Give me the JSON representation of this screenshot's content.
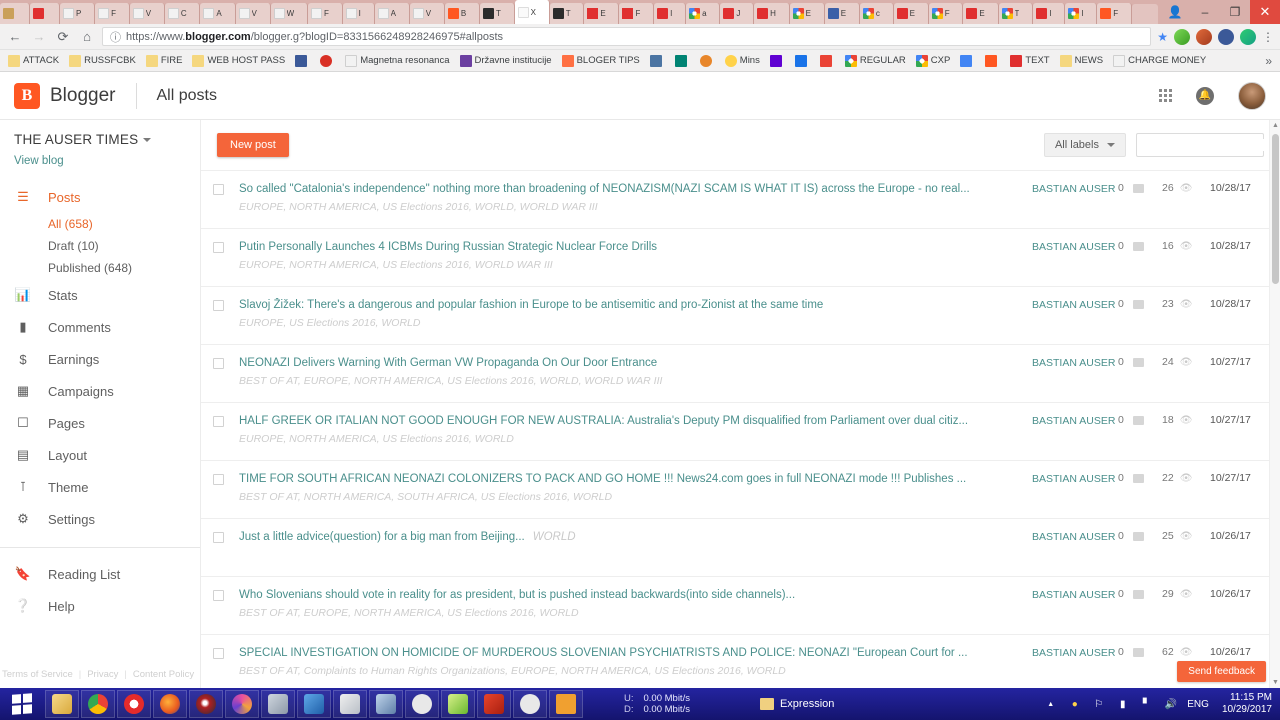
{
  "browser": {
    "window_controls": {
      "minimize": "–",
      "maximize": "❐",
      "close": "✕"
    },
    "nav": {
      "back": "←",
      "forward": "→",
      "reload": "⟳",
      "home": "⌂",
      "info": "ⓘ",
      "star": "★",
      "menu": "⋮"
    },
    "url": {
      "scheme": "https://www.",
      "host": "blogger.com",
      "path": "/blogger.g?blogID=8331566248928246975#allposts"
    },
    "tabs": [
      {
        "label": "",
        "favicon": "shopping-bag",
        "active": false
      },
      {
        "label": "",
        "favicon": "youtube",
        "active": false
      },
      {
        "label": "P",
        "favicon": "page",
        "active": false
      },
      {
        "label": "F",
        "favicon": "page",
        "active": false
      },
      {
        "label": "V",
        "favicon": "page",
        "active": false
      },
      {
        "label": "C",
        "favicon": "page",
        "active": false
      },
      {
        "label": "A",
        "favicon": "page",
        "active": false
      },
      {
        "label": "V",
        "favicon": "page",
        "active": false
      },
      {
        "label": "W",
        "favicon": "page",
        "active": false
      },
      {
        "label": "F",
        "favicon": "page",
        "active": false
      },
      {
        "label": "I",
        "favicon": "page",
        "active": false
      },
      {
        "label": "A",
        "favicon": "page",
        "active": false
      },
      {
        "label": "V",
        "favicon": "page",
        "active": false
      },
      {
        "label": "B",
        "favicon": "blogger",
        "active": false
      },
      {
        "label": "T",
        "favicon": "serif-a",
        "active": false
      },
      {
        "label": "X",
        "favicon": "text",
        "active": true
      },
      {
        "label": "T",
        "favicon": "serif-a",
        "active": false
      },
      {
        "label": "E",
        "favicon": "check",
        "active": false
      },
      {
        "label": "F",
        "favicon": "check",
        "active": false
      },
      {
        "label": "I",
        "favicon": "youtube",
        "active": false
      },
      {
        "label": "a",
        "favicon": "google",
        "active": false
      },
      {
        "label": "J",
        "favicon": "youtube",
        "active": false
      },
      {
        "label": "H",
        "favicon": "youtube",
        "active": false
      },
      {
        "label": "E",
        "favicon": "google",
        "active": false
      },
      {
        "label": "E",
        "favicon": "blue-doc",
        "active": false
      },
      {
        "label": "c",
        "favicon": "google",
        "active": false
      },
      {
        "label": "E",
        "favicon": "youtube",
        "active": false
      },
      {
        "label": "F",
        "favicon": "google",
        "active": false
      },
      {
        "label": "E",
        "favicon": "youtube",
        "active": false
      },
      {
        "label": "T",
        "favicon": "google",
        "active": false
      },
      {
        "label": "I",
        "favicon": "youtube",
        "active": false
      },
      {
        "label": "I",
        "favicon": "google",
        "active": false
      },
      {
        "label": "F",
        "favicon": "blogger",
        "active": false
      }
    ],
    "bookmarks": [
      {
        "label": "ATTACK",
        "icon": "folder"
      },
      {
        "label": "RUSSFCBK",
        "icon": "folder"
      },
      {
        "label": "FIRE",
        "icon": "folder"
      },
      {
        "label": "WEB HOST PASS",
        "icon": "folder"
      },
      {
        "label": "",
        "icon": "facebook"
      },
      {
        "label": "",
        "icon": "red-drop"
      },
      {
        "label": "Magnetna resonanca",
        "icon": "page"
      },
      {
        "label": "Državne institucije",
        "icon": "purple-v"
      },
      {
        "label": "BLOGER TIPS",
        "icon": "orange-bg"
      },
      {
        "label": "",
        "icon": "vk"
      },
      {
        "label": "",
        "icon": "bing"
      },
      {
        "label": "",
        "icon": "orange-circle"
      },
      {
        "label": "Mins",
        "icon": "bulb"
      },
      {
        "label": "",
        "icon": "yahoo"
      },
      {
        "label": "",
        "icon": "blue-square"
      },
      {
        "label": "",
        "icon": "gmail"
      },
      {
        "label": "REGULAR",
        "icon": "google"
      },
      {
        "label": "CXP",
        "icon": "google"
      },
      {
        "label": "",
        "icon": "translate"
      },
      {
        "label": "",
        "icon": "blogger"
      },
      {
        "label": "TEXT",
        "icon": "red-check"
      },
      {
        "label": "NEWS",
        "icon": "folder"
      },
      {
        "label": "CHARGE MONEY",
        "icon": "page"
      }
    ],
    "bookmarks_overflow": "»"
  },
  "app": {
    "brand": {
      "mark": "B",
      "name": "Blogger"
    },
    "page_title": "All posts",
    "header_icons": {
      "apps": "apps-grid",
      "notifications": "bell",
      "account": "avatar"
    }
  },
  "sidebar": {
    "blog_name": "THE AUSER TIMES",
    "view_blog": "View blog",
    "items": [
      {
        "label": "Posts",
        "icon": "posts-icon",
        "active": true
      },
      {
        "label": "Stats",
        "icon": "stats-icon",
        "active": false
      },
      {
        "label": "Comments",
        "icon": "comments-icon",
        "active": false
      },
      {
        "label": "Earnings",
        "icon": "earnings-icon",
        "active": false
      },
      {
        "label": "Campaigns",
        "icon": "campaigns-icon",
        "active": false
      },
      {
        "label": "Pages",
        "icon": "pages-icon",
        "active": false
      },
      {
        "label": "Layout",
        "icon": "layout-icon",
        "active": false
      },
      {
        "label": "Theme",
        "icon": "theme-icon",
        "active": false
      },
      {
        "label": "Settings",
        "icon": "settings-icon",
        "active": false
      }
    ],
    "subitems": [
      {
        "label": "All (658)",
        "active": true
      },
      {
        "label": "Draft (10)",
        "active": false
      },
      {
        "label": "Published (648)",
        "active": false
      }
    ],
    "bottom_items": [
      {
        "label": "Reading List",
        "icon": "bookmark-icon"
      },
      {
        "label": "Help",
        "icon": "help-icon"
      }
    ],
    "footer": {
      "terms": "Terms of Service",
      "privacy": "Privacy",
      "policy": "Content Policy",
      "sep": "|"
    }
  },
  "toolbar": {
    "new_post_label": "New post",
    "labels_filter": "All labels",
    "search_value": "",
    "search_placeholder": ""
  },
  "posts": [
    {
      "title": "So called \"Catalonia's independence\" nothing more than broadening of NEONAZISM(NAZI SCAM IS WHAT IT IS) across the Europe - no real...",
      "labels": "EUROPE, NORTH AMERICA, US Elections 2016, WORLD, WORLD WAR III",
      "inline_labels": "",
      "author": "BASTIAN AUSER",
      "comments": "0",
      "views": "26",
      "date": "10/28/17"
    },
    {
      "title": "Putin Personally Launches 4 ICBMs During Russian Strategic Nuclear Force Drills",
      "labels": "EUROPE, NORTH AMERICA, US Elections 2016, WORLD WAR III",
      "inline_labels": "",
      "author": "BASTIAN AUSER",
      "comments": "0",
      "views": "16",
      "date": "10/28/17"
    },
    {
      "title": "Slavoj Žižek: There's a dangerous and popular fashion in Europe to be antisemitic and pro-Zionist at the same time",
      "labels": "EUROPE, US Elections 2016, WORLD",
      "inline_labels": "",
      "author": "BASTIAN AUSER",
      "comments": "0",
      "views": "23",
      "date": "10/28/17"
    },
    {
      "title": "NEONAZI Delivers Warning With German VW Propaganda On Our Door Entrance",
      "labels": "BEST OF AT, EUROPE, NORTH AMERICA, US Elections 2016, WORLD, WORLD WAR III",
      "inline_labels": "",
      "author": "BASTIAN AUSER",
      "comments": "0",
      "views": "24",
      "date": "10/27/17"
    },
    {
      "title": "HALF GREEK OR ITALIAN NOT GOOD ENOUGH FOR NEW AUSTRALIA: Australia's Deputy PM disqualified from Parliament over dual citiz...",
      "labels": "EUROPE, NORTH AMERICA, US Elections 2016, WORLD",
      "inline_labels": "",
      "author": "BASTIAN AUSER",
      "comments": "0",
      "views": "18",
      "date": "10/27/17"
    },
    {
      "title": "TIME FOR SOUTH AFRICAN NEONAZI COLONIZERS TO PACK AND GO HOME !!! News24.com goes in full NEONAZI mode !!! Publishes ...",
      "labels": "BEST OF AT, NORTH AMERICA, SOUTH AFRICA, US Elections 2016, WORLD",
      "inline_labels": "",
      "author": "BASTIAN AUSER",
      "comments": "0",
      "views": "22",
      "date": "10/27/17"
    },
    {
      "title": "Just a little advice(question) for a big man from Beijing...",
      "labels": "",
      "inline_labels": "WORLD",
      "author": "BASTIAN AUSER",
      "comments": "0",
      "views": "25",
      "date": "10/26/17"
    },
    {
      "title": "Who Slovenians should vote in reality for as president, but is pushed instead backwards(into side channels)...",
      "labels": "BEST OF AT, EUROPE, NORTH AMERICA, US Elections 2016, WORLD",
      "inline_labels": "",
      "author": "BASTIAN AUSER",
      "comments": "0",
      "views": "29",
      "date": "10/26/17"
    },
    {
      "title": "SPECIAL INVESTIGATION ON HOMICIDE OF MURDEROUS SLOVENIAN PSYCHIATRISTS AND POLICE: NEONAZI \"European Court for ...",
      "labels": "BEST OF AT, Complaints to Human Rights Organizations, EUROPE, NORTH AMERICA, US Elections 2016, WORLD",
      "inline_labels": "",
      "author": "BASTIAN AUSER",
      "comments": "0",
      "views": "62",
      "date": "10/26/17"
    }
  ],
  "feedback_label": "Send feedback",
  "taskbar": {
    "start": "windows-logo",
    "apps": [
      {
        "name": "file-explorer"
      },
      {
        "name": "google-chrome"
      },
      {
        "name": "opera"
      },
      {
        "name": "firefox"
      },
      {
        "name": "dark-browser"
      },
      {
        "name": "spiral-app"
      },
      {
        "name": "printer"
      },
      {
        "name": "media-app"
      },
      {
        "name": "document-app"
      },
      {
        "name": "monitor-app"
      },
      {
        "name": "settings-app"
      },
      {
        "name": "notepadpp"
      },
      {
        "name": "ccleaner"
      },
      {
        "name": "settings-app-2"
      },
      {
        "name": "video-player"
      }
    ],
    "network": {
      "up_label": "U:",
      "up_value": "0.00 Mbit/s",
      "down_label": "D:",
      "down_value": "0.00 Mbit/s"
    },
    "window_label": "Expression",
    "tray": {
      "show_hidden": "▲",
      "lang": "ENG"
    },
    "clock_time": "11:15 PM",
    "clock_date": "10/29/2017"
  },
  "colors": {
    "accent": "#f4653a",
    "link": "#4a8f8c",
    "active_nav": "#e8662a",
    "taskbar": "#1c1c8c"
  }
}
